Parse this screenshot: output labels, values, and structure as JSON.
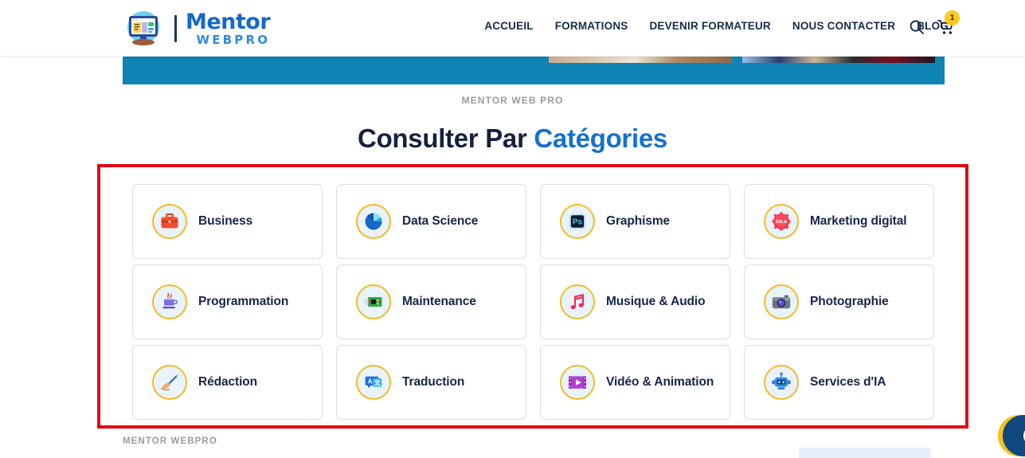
{
  "header": {
    "logo": {
      "icon": "monitor-logo-icon",
      "title": "Mentor",
      "subtitle": "WEBPRO"
    },
    "nav_items": [
      {
        "label": "ACCUEIL",
        "name": "nav-accueil"
      },
      {
        "label": "FORMATIONS",
        "name": "nav-formations"
      },
      {
        "label": "DEVENIR FORMATEUR",
        "name": "nav-devenir-formateur"
      },
      {
        "label": "NOUS CONTACTER",
        "name": "nav-nous-contacter"
      },
      {
        "label": "BLOG",
        "name": "nav-blog"
      }
    ],
    "search_icon": "search-icon",
    "cart_icon": "cart-icon",
    "cart_count": "1"
  },
  "section": {
    "eyebrow": "MENTOR WEB PRO",
    "title_part1": "Consulter Par ",
    "title_accent": "Catégories"
  },
  "categories": [
    {
      "label": "Business",
      "icon": "briefcase-icon"
    },
    {
      "label": "Data Science",
      "icon": "pie-chart-icon"
    },
    {
      "label": "Graphisme",
      "icon": "photoshop-icon"
    },
    {
      "label": "Marketing digital",
      "icon": "sale-badge-icon"
    },
    {
      "label": "Programmation",
      "icon": "java-coffee-icon"
    },
    {
      "label": "Maintenance",
      "icon": "circuit-board-icon"
    },
    {
      "label": "Musique & Audio",
      "icon": "music-note-icon"
    },
    {
      "label": "Photographie",
      "icon": "camera-icon"
    },
    {
      "label": "Rédaction",
      "icon": "writing-hand-icon"
    },
    {
      "label": "Traduction",
      "icon": "translate-icon"
    },
    {
      "label": "Vidéo & Animation",
      "icon": "film-play-icon"
    },
    {
      "label": "Services d'IA",
      "icon": "robot-icon"
    }
  ],
  "footer": {
    "eyebrow": "MENTOR WEBPRO"
  },
  "colors": {
    "accent_blue": "#1570d1",
    "navy": "#17254a",
    "banner_teal": "#0f84b5",
    "badge_yellow": "#ffc91d",
    "icon_ring": "#f5bb22",
    "selection_red": "#e30613"
  }
}
